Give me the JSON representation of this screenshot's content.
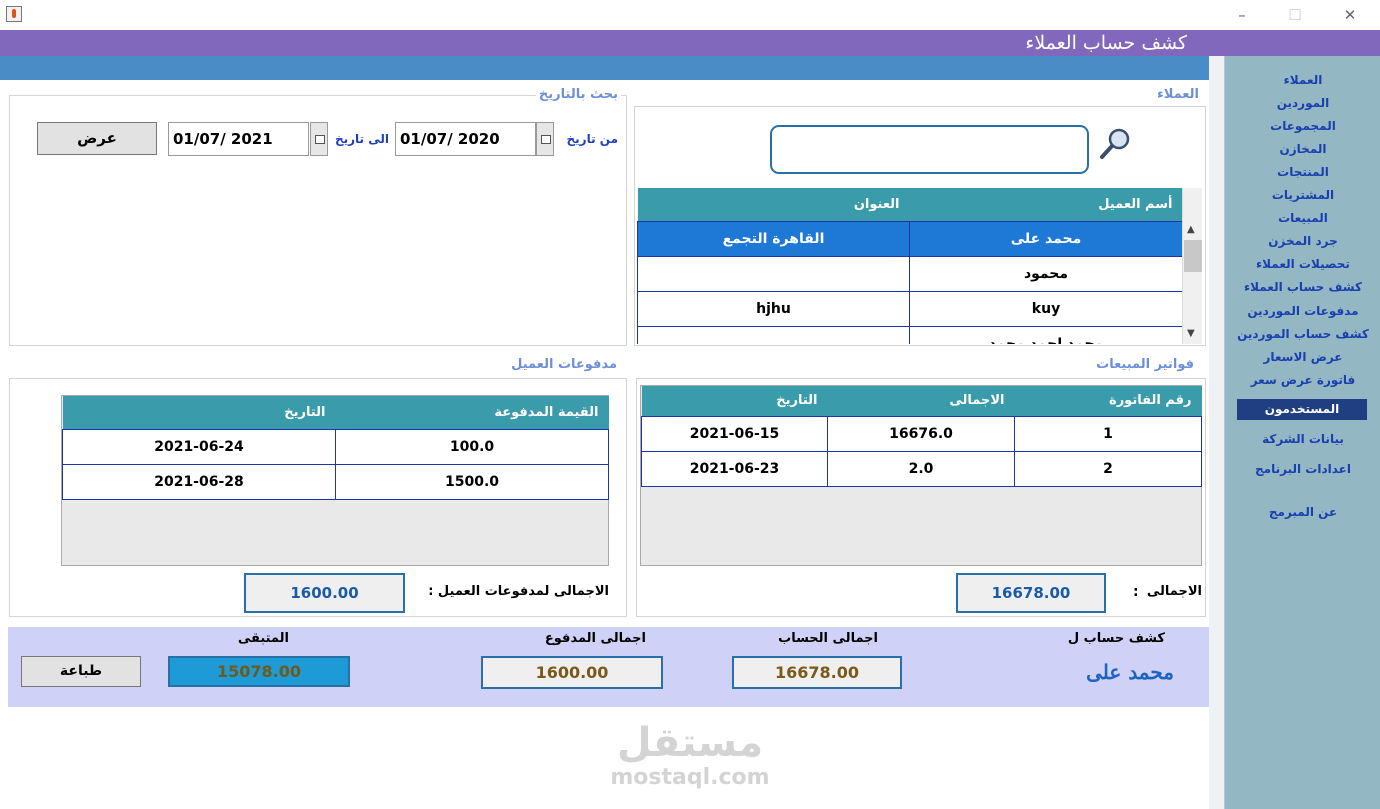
{
  "header": {
    "title": "كشف حساب العملاء"
  },
  "sidebar": {
    "items": [
      "العملاء",
      "الموردين",
      "المجموعات",
      "المخازن",
      "المنتجات",
      "المشتريات",
      "المبيعات",
      "جرد المخزن",
      "تحصيلات العملاء",
      "كشف حساب العملاء",
      "مدفوعات  الموردين",
      "كشف حساب  الموردين",
      "عرض الاسعار",
      "فاتورة عرض سعر"
    ],
    "active": "المستخدمون",
    "lower_items": [
      "بيانات الشركة",
      "اعدادات البرنامج",
      "عن المبرمج"
    ]
  },
  "date_search": {
    "title": "بحث بالتاريخ",
    "from_label": "من تاريخ",
    "from_value": "01/07/ 2020",
    "to_label": "الى تاريخ",
    "to_value": "01/07/ 2021",
    "show_button": "عرض"
  },
  "customers": {
    "title": "العملاء",
    "search_value": "",
    "columns": [
      "أسم العميل",
      "العنوان"
    ],
    "rows": [
      {
        "name": "محمد على",
        "address": "القاهرة التجمع"
      },
      {
        "name": "محمود",
        "address": ""
      },
      {
        "name": "kuy",
        "address": "hjhu"
      },
      {
        "name": "محمد احمد محمد",
        "address": ""
      }
    ]
  },
  "payments": {
    "title": "مدفوعات العميل",
    "columns": [
      "القيمة المدفوعة",
      "التاريخ"
    ],
    "rows": [
      {
        "amount": "100.0",
        "date": "2021-06-24"
      },
      {
        "amount": "1500.0",
        "date": "2021-06-28"
      }
    ],
    "total_label": "الاجمالى لمدفوعات العميل :",
    "total_value": "1600.00"
  },
  "invoices": {
    "title": "فواتير المبيعات",
    "columns": [
      "رقم الفاتورة",
      "الاجمالى",
      "التاريخ"
    ],
    "rows": [
      {
        "no": "1",
        "total": "16676.0",
        "date": "2021-06-15"
      },
      {
        "no": "2",
        "total": "2.0",
        "date": "2021-06-23"
      }
    ],
    "total_label": "الاجمالى",
    "colon": ":",
    "total_value": "16678.00"
  },
  "summary": {
    "statement_label": "كشف حساب ل",
    "customer_name": "محمد على",
    "account_total_label": "اجمالى الحساب",
    "account_total_value": "16678.00",
    "paid_total_label": "اجمالى المدفوع",
    "paid_total_value": "1600.00",
    "remaining_label": "المتبقى",
    "remaining_value": "15078.00",
    "print_button": "طباعة"
  },
  "watermark": {
    "text": "مستقل",
    "sub": "mostaql.com"
  }
}
